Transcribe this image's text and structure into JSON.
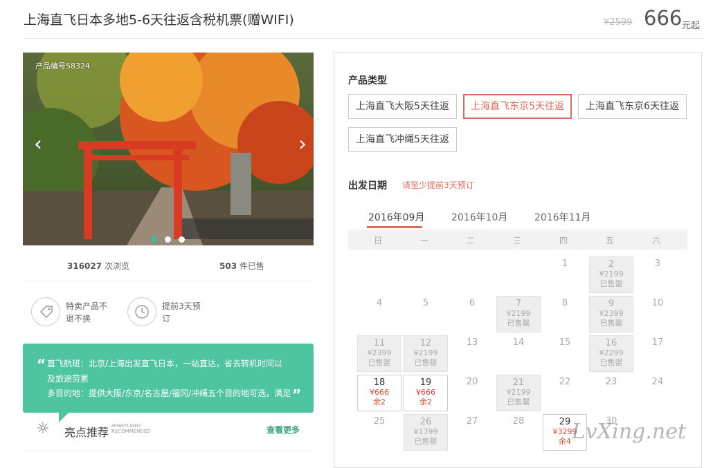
{
  "header": {
    "title": "上海直飞日本多地5-6天往返含税机票(赠WIFI)",
    "price_original": "¥2599",
    "price": "666",
    "price_unit": "元起"
  },
  "gallery": {
    "product_code": "产品编号58324",
    "slide_count": 3,
    "active_slide": 1
  },
  "stats": {
    "views": "316027",
    "views_label": "次浏览",
    "sold": "503",
    "sold_label": "件已售"
  },
  "features": [
    {
      "icon": "tag-icon",
      "line1": "特卖产品不",
      "line2": "退不换"
    },
    {
      "icon": "clock-icon",
      "line1": "提前3天预",
      "line2": "订"
    }
  ],
  "highlight": {
    "line1": "直飞航班：北京/上海出发直飞日本，一站直达，省去转机时间以",
    "line2": "及旅途劳累",
    "line3": "多目的地：提供大阪/东京/名古屋/福冈/冲绳五个目的地可选，满足"
  },
  "recommend": {
    "title": "亮点推荐",
    "sub1": "HIGHTLIGHT",
    "sub2": "RECOMMENDED",
    "more": "查看更多"
  },
  "product_types": {
    "title": "产品类型",
    "options": [
      "上海直飞大阪5天往返",
      "上海直飞东京5天往返",
      "上海直飞东京6天往返",
      "上海直飞冲绳5天往返"
    ],
    "selected": "上海直飞东京5天往返"
  },
  "departure": {
    "title": "出发日期",
    "hint": "请至少提前3天预订",
    "months": [
      "2016年09月",
      "2016年10月",
      "2016年11月"
    ],
    "active_month": "2016年09月",
    "weekdays": [
      "日",
      "一",
      "二",
      "三",
      "四",
      "五",
      "六"
    ],
    "days": [
      {
        "d": "1"
      },
      {
        "d": "2",
        "status": "sold",
        "price": "¥2199",
        "note": "已售罄"
      },
      {
        "d": "3"
      },
      {
        "d": "4"
      },
      {
        "d": "5"
      },
      {
        "d": "6"
      },
      {
        "d": "7",
        "status": "sold",
        "price": "¥2199",
        "note": "已售罄"
      },
      {
        "d": "8"
      },
      {
        "d": "9",
        "status": "sold",
        "price": "¥2399",
        "note": "已售罄"
      },
      {
        "d": "10"
      },
      {
        "d": "11",
        "status": "sold",
        "price": "¥2399",
        "note": "已售罄"
      },
      {
        "d": "12",
        "status": "sold",
        "price": "¥2199",
        "note": "已售罄"
      },
      {
        "d": "13"
      },
      {
        "d": "14"
      },
      {
        "d": "15"
      },
      {
        "d": "16",
        "status": "sold",
        "price": "¥2299",
        "note": "已售罄"
      },
      {
        "d": "17"
      },
      {
        "d": "18",
        "status": "avail",
        "price": "¥666",
        "note": "余2"
      },
      {
        "d": "19",
        "status": "avail",
        "price": "¥666",
        "note": "余2"
      },
      {
        "d": "20"
      },
      {
        "d": "21",
        "status": "sold",
        "price": "¥2199",
        "note": "已售罄"
      },
      {
        "d": "22"
      },
      {
        "d": "23"
      },
      {
        "d": "24"
      },
      {
        "d": "25"
      },
      {
        "d": "26",
        "status": "sold",
        "price": "¥1799",
        "note": "已售罄"
      },
      {
        "d": "27"
      },
      {
        "d": "28"
      },
      {
        "d": "29",
        "status": "avail",
        "price": "¥3299",
        "note": "余4"
      },
      {
        "d": "30"
      }
    ],
    "first_weekday": 4
  },
  "watermark": "LvXing.net",
  "colors": {
    "accent_red": "#e26a5a",
    "green_card": "#4fc4a0",
    "active_dot": "#3bbf98"
  }
}
